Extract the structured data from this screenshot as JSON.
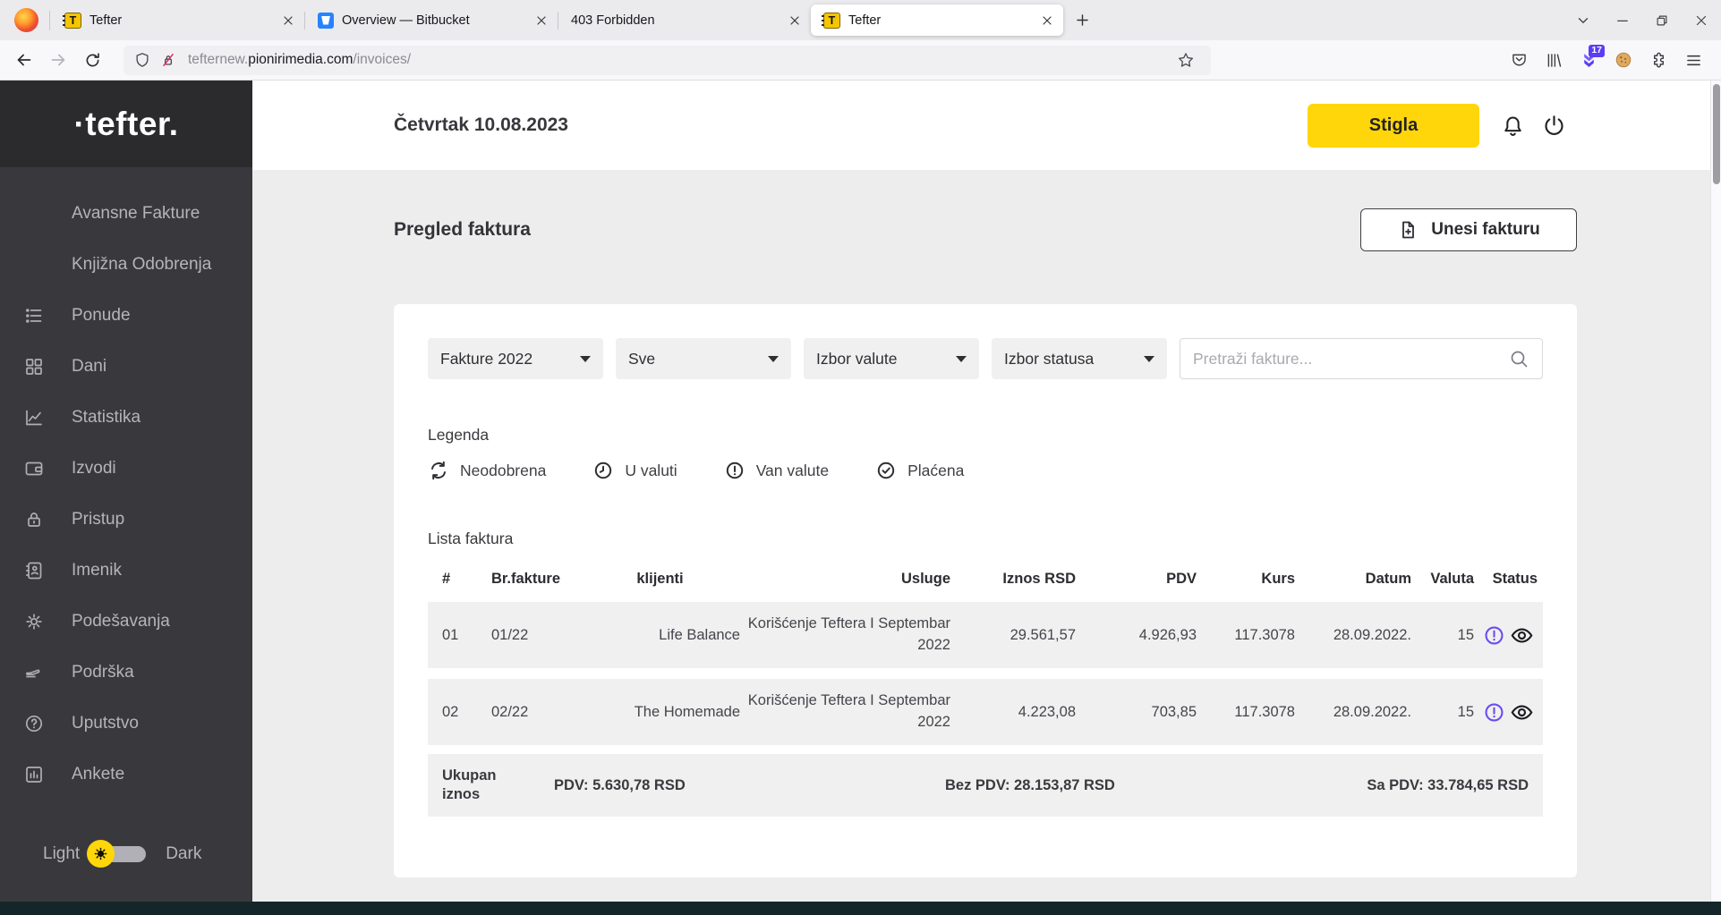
{
  "browser": {
    "tabs": [
      {
        "title": "Tefter"
      },
      {
        "title": "Overview — Bitbucket"
      },
      {
        "title": "403 Forbidden"
      },
      {
        "title": "Tefter"
      }
    ],
    "favicon_letter": "T",
    "url": {
      "prefix": "tefternew.",
      "host": "pionirimedia.com",
      "path": "/invoices/"
    },
    "download_badge": "17"
  },
  "sidebar": {
    "logo": "·tefter.",
    "items": [
      {
        "label": "Avansne Fakture"
      },
      {
        "label": "Knjižna Odobrenja"
      },
      {
        "label": "Ponude"
      },
      {
        "label": "Dani"
      },
      {
        "label": "Statistika"
      },
      {
        "label": "Izvodi"
      },
      {
        "label": "Pristup"
      },
      {
        "label": "Imenik"
      },
      {
        "label": "Podešavanja"
      },
      {
        "label": "Podrška"
      },
      {
        "label": "Uputstvo"
      },
      {
        "label": "Ankete"
      }
    ],
    "theme_toggle": {
      "light": "Light",
      "dark": "Dark"
    }
  },
  "header": {
    "date": "Četvrtak 10.08.2023",
    "status_button": "Stigla"
  },
  "page": {
    "title": "Pregled faktura",
    "add_invoice_button": "Unesi fakturu"
  },
  "filters": {
    "year": "Fakture 2022",
    "client": "Sve",
    "currency": "Izbor valute",
    "status": "Izbor statusa",
    "search_placeholder": "Pretraži fakture..."
  },
  "legend": {
    "title": "Legenda",
    "items": [
      {
        "label": "Neodobrena"
      },
      {
        "label": "U valuti"
      },
      {
        "label": "Van valute"
      },
      {
        "label": "Plaćena"
      }
    ]
  },
  "table": {
    "title": "Lista faktura",
    "columns": [
      "#",
      "Br.fakture",
      "klijenti",
      "Usluge",
      "Iznos RSD",
      "PDV",
      "Kurs",
      "Datum",
      "Valuta",
      "Status"
    ],
    "rows": [
      {
        "num": "01",
        "br": "01/22",
        "klijent": "Life Balance",
        "usluga": "Korišćenje Teftera I Septembar 2022",
        "iznos": "29.561,57",
        "pdv": "4.926,93",
        "kurs": "117.3078",
        "datum": "28.09.2022.",
        "valuta": "15"
      },
      {
        "num": "02",
        "br": "02/22",
        "klijent": "The Homemade",
        "usluga": "Korišćenje Teftera I Septembar 2022",
        "iznos": "4.223,08",
        "pdv": "703,85",
        "kurs": "117.3078",
        "datum": "28.09.2022.",
        "valuta": "15"
      }
    ],
    "footer": {
      "label": "Ukupan iznos",
      "pdv": "PDV: 5.630,78 RSD",
      "bez_pdv": "Bez PDV: 28.153,87 RSD",
      "sa_pdv": "Sa PDV: 33.784,65 RSD"
    }
  },
  "colors": {
    "accent_yellow": "#ffd60a",
    "status_purple": "#6b4cf0",
    "sidebar_bg": "#39393d",
    "sidebar_logo_bg": "#2b2b2d",
    "content_bg": "#ededee",
    "row_bg": "#f0f0f1",
    "bottom_strip": "#15262a"
  }
}
